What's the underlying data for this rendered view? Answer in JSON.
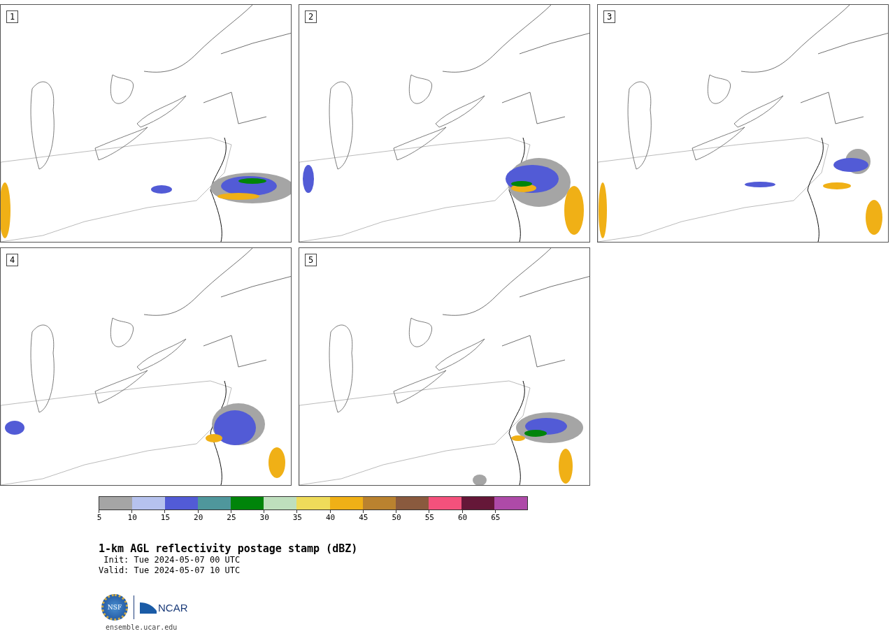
{
  "panels": [
    {
      "label": "1"
    },
    {
      "label": "2"
    },
    {
      "label": "3"
    },
    {
      "label": "4"
    },
    {
      "label": "5"
    }
  ],
  "colorbar": {
    "bins": [
      {
        "color": "#a5a5a5"
      },
      {
        "color": "#b6c2ee"
      },
      {
        "color": "#525bd6"
      },
      {
        "color": "#4f979c"
      },
      {
        "color": "#00840a"
      },
      {
        "color": "#bedfbd"
      },
      {
        "color": "#eedb5a"
      },
      {
        "color": "#f0b016"
      },
      {
        "color": "#ba822f"
      },
      {
        "color": "#8a5a3e"
      },
      {
        "color": "#f4517c"
      },
      {
        "color": "#651738"
      },
      {
        "color": "#ae4aa8"
      }
    ],
    "ticks": [
      "5",
      "10",
      "15",
      "20",
      "25",
      "30",
      "35",
      "40",
      "45",
      "50",
      "55",
      "60",
      "65"
    ]
  },
  "title": "1-km AGL reflectivity postage stamp (dBZ)",
  "init": " Init: Tue 2024-05-07 00 UTC",
  "valid": "Valid: Tue 2024-05-07 10 UTC",
  "logo": {
    "seal": "NSF",
    "wordmark": "NCAR"
  },
  "website": "ensemble.ucar.edu"
}
